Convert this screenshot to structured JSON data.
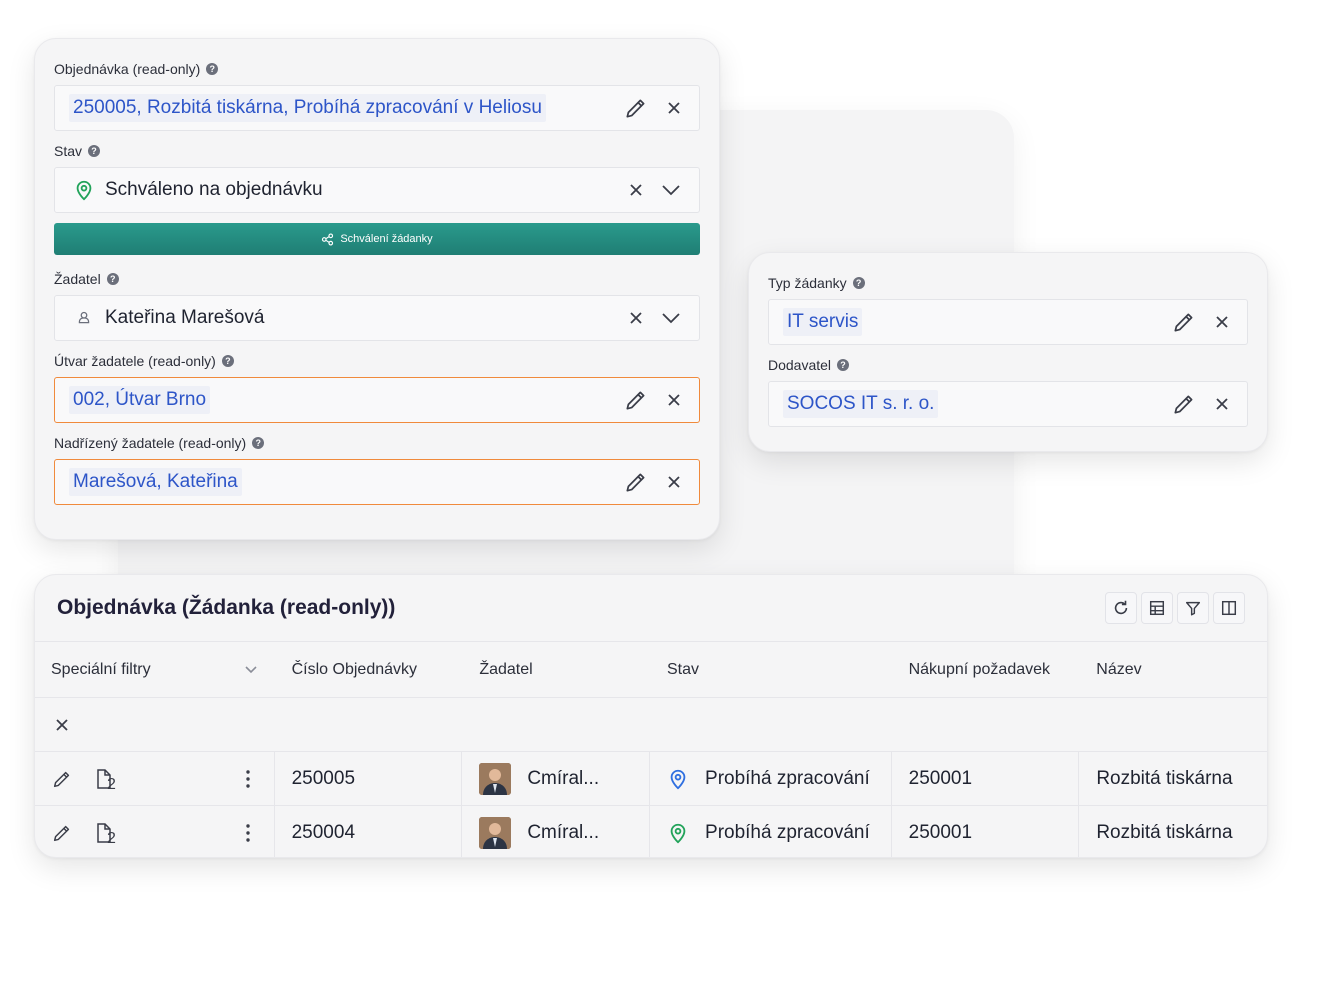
{
  "form": {
    "order": {
      "label": "Objednávka (read-only)",
      "value": "250005, Rozbitá tiskárna, Probíhá zpracování v Heliosu"
    },
    "status": {
      "label": "Stav",
      "value": "Schváleno na objednávku"
    },
    "approve_button": "Schválení žádanky",
    "requester": {
      "label": "Žadatel",
      "value": "Kateřina Marešová"
    },
    "department": {
      "label": "Útvar žadatele (read-only)",
      "value": "002, Útvar Brno"
    },
    "supervisor": {
      "label": "Nadřízený žadatele (read-only)",
      "value": "Marešová, Kateřina"
    }
  },
  "side": {
    "request_type": {
      "label": "Typ žádanky",
      "value": "IT servis"
    },
    "supplier": {
      "label": "Dodavatel",
      "value": "SOCOS IT s. r. o."
    }
  },
  "table": {
    "title": "Objednávka (Žádanka (read-only))",
    "toolbar_icons": [
      "refresh-icon",
      "table-icon",
      "filter-icon",
      "columns-icon"
    ],
    "columns": [
      "Speciální filtry",
      "Číslo Objednávky",
      "Žadatel",
      "Stav",
      "Nákupní požadavek",
      "Název"
    ],
    "attachment_count": "2",
    "rows": [
      {
        "number": "250005",
        "requester": "Cmíral...",
        "status": "Probíhá zpracování",
        "status_color": "#2f6fe0",
        "purchase_request": "250001",
        "name": "Rozbitá tiskárna"
      },
      {
        "number": "250004",
        "requester": "Cmíral...",
        "status": "Probíhá zpracování",
        "status_color": "#22a35a",
        "purchase_request": "250001",
        "name": "Rozbitá tiskárna"
      }
    ]
  },
  "colors": {
    "accent_teal": "#1f7e74",
    "link_blue": "#2d55c8",
    "readonly_border": "#f08a3c",
    "status_green": "#22a35a"
  }
}
